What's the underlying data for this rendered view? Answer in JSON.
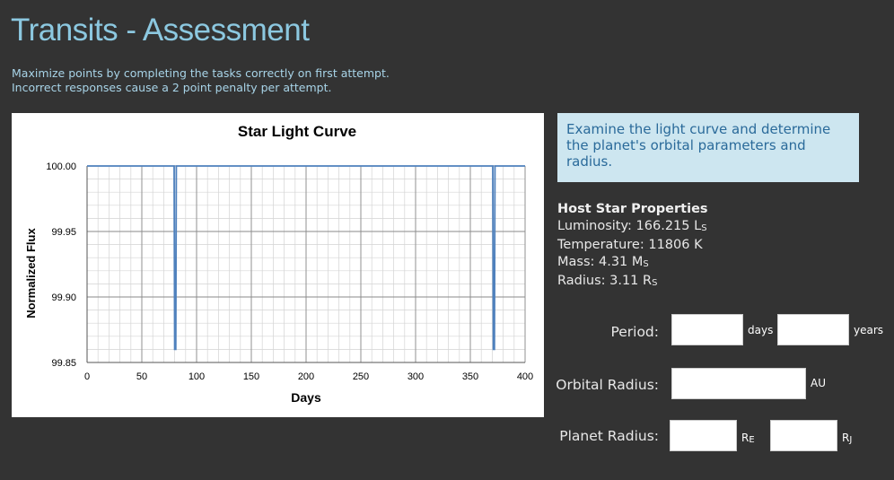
{
  "page": {
    "title": "Transits - Assessment",
    "instructions_line1": "Maximize points by completing the tasks correctly on first attempt.",
    "instructions_line2": "Incorrect responses cause a 2 point penalty per attempt."
  },
  "task": {
    "text": "Examine the light curve and determine the planet's orbital parameters and radius."
  },
  "host_star": {
    "heading": "Host Star Properties",
    "luminosity_label": "Luminosity:",
    "luminosity_value": "166.215",
    "luminosity_unit": "L",
    "luminosity_sub": "S",
    "temperature_label": "Temperature:",
    "temperature_value": "11806 K",
    "mass_label": "Mass:",
    "mass_value": "4.31",
    "mass_unit": "M",
    "mass_sub": "S",
    "radius_label": "Radius:",
    "radius_value": "3.11",
    "radius_unit": "R",
    "radius_sub": "S"
  },
  "form": {
    "period_label": "Period:",
    "period_days_value": "",
    "period_days_unit": "days",
    "period_years_value": "",
    "period_years_unit": "years",
    "orbital_radius_label": "Orbital Radius:",
    "orbital_radius_value": "",
    "orbital_radius_unit": "AU",
    "planet_radius_label": "Planet Radius:",
    "planet_radius_earth_value": "",
    "planet_radius_earth_unit": "R",
    "planet_radius_earth_sub": "E",
    "planet_radius_jupiter_value": "",
    "planet_radius_jupiter_unit": "R",
    "planet_radius_jupiter_sub": "J"
  },
  "chart_data": {
    "type": "line",
    "title": "Star Light Curve",
    "xlabel": "Days",
    "ylabel": "Normalized Flux",
    "xlim": [
      0,
      400
    ],
    "ylim": [
      99.85,
      100.0
    ],
    "xticks": [
      "0",
      "50",
      "100",
      "150",
      "200",
      "250",
      "300",
      "350",
      "400"
    ],
    "yticks": [
      "99.85",
      "99.90",
      "99.95",
      "100.00"
    ],
    "grid": true,
    "series": [
      {
        "color": "#4f81bd",
        "x": [
          0,
          79.5,
          80,
          81,
          81.5,
          370.5,
          371,
          372,
          372.5,
          400
        ],
        "y": [
          100.0,
          100.0,
          99.86,
          99.86,
          100.0,
          100.0,
          99.86,
          99.86,
          100.0,
          100.0
        ]
      }
    ]
  }
}
